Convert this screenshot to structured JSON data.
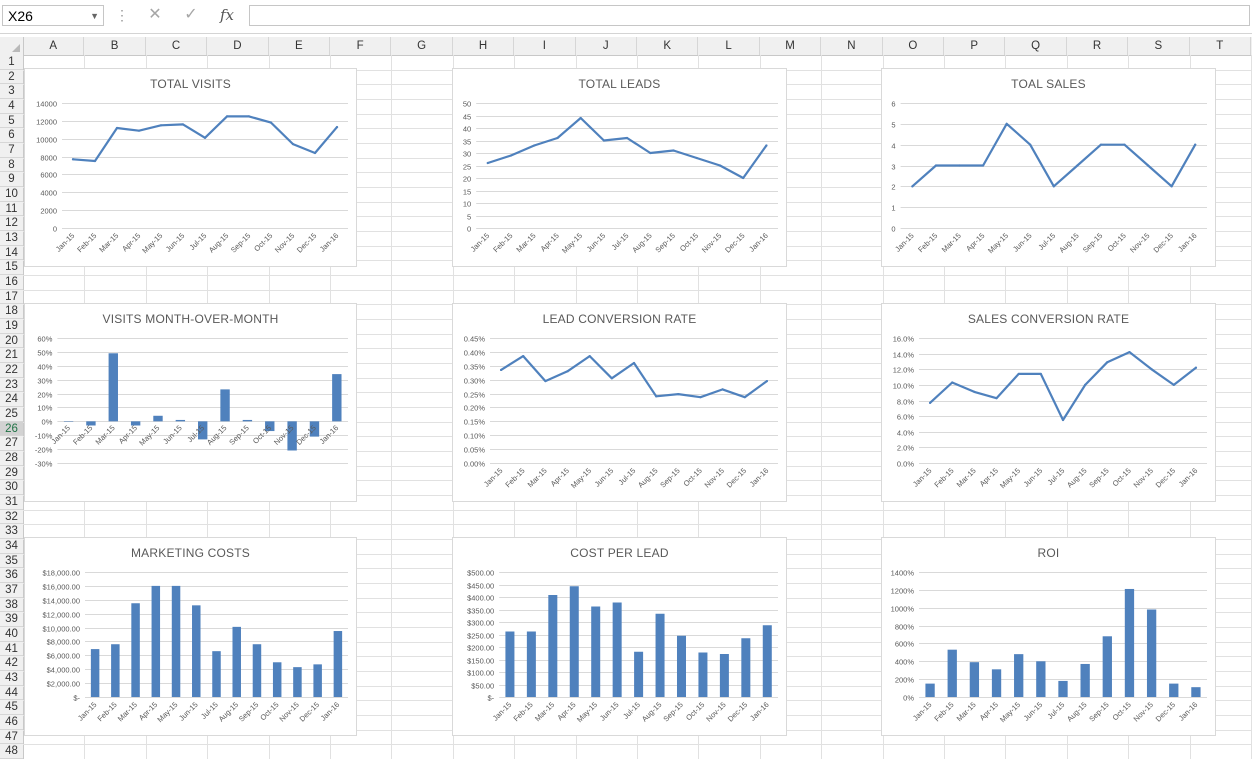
{
  "formula_bar": {
    "name_box": "X26",
    "fx_label": "fx",
    "formula": ""
  },
  "columns": [
    "A",
    "B",
    "C",
    "D",
    "E",
    "F",
    "G",
    "H",
    "I",
    "J",
    "K",
    "L",
    "M",
    "N",
    "O",
    "P",
    "Q",
    "R",
    "S",
    "T"
  ],
  "rows": [
    "1",
    "2",
    "3",
    "4",
    "5",
    "6",
    "7",
    "8",
    "9",
    "10",
    "11",
    "12",
    "13",
    "14",
    "15",
    "16",
    "17",
    "18",
    "19",
    "20",
    "21",
    "22",
    "23",
    "24",
    "25",
    "26",
    "27",
    "28",
    "29",
    "30",
    "31",
    "32",
    "33",
    "34",
    "35",
    "36",
    "37",
    "38",
    "39",
    "40",
    "41",
    "42",
    "43",
    "44",
    "45",
    "46",
    "47",
    "48"
  ],
  "selected_row": "26",
  "colors": {
    "series": "#4f81bd",
    "gridline": "#d9d9d9",
    "axis_text": "#595959",
    "header_bg": "#f0f0f0"
  },
  "chart_data": [
    {
      "type": "line",
      "title": "TOTAL VISITS",
      "categories": [
        "Jan-15",
        "Feb-15",
        "Mar-15",
        "Apr-15",
        "May-15",
        "Jun-15",
        "Jul-15",
        "Aug-15",
        "Sep-15",
        "Oct-15",
        "Nov-15",
        "Dec-15",
        "Jan-16"
      ],
      "values": [
        7700,
        7500,
        11200,
        10900,
        11500,
        11600,
        10100,
        12500,
        12500,
        11800,
        9400,
        8400,
        11300
      ],
      "yticks": [
        0,
        2000,
        4000,
        6000,
        8000,
        10000,
        12000,
        14000
      ],
      "ytick_labels": [
        "0",
        "2000",
        "4000",
        "6000",
        "8000",
        "10000",
        "12000",
        "14000"
      ],
      "ylim": [
        0,
        14000
      ]
    },
    {
      "type": "line",
      "title": "TOTAL LEADS",
      "categories": [
        "Jan-15",
        "Feb-15",
        "Mar-15",
        "Apr-15",
        "May-15",
        "Jun-15",
        "Jul-15",
        "Aug-15",
        "Sep-15",
        "Oct-15",
        "Nov-15",
        "Dec-15",
        "Jan-16"
      ],
      "values": [
        26,
        29,
        33,
        36,
        44,
        35,
        36,
        30,
        31,
        28,
        25,
        20,
        33
      ],
      "yticks": [
        0,
        5,
        10,
        15,
        20,
        25,
        30,
        35,
        40,
        45,
        50
      ],
      "ytick_labels": [
        "0",
        "5",
        "10",
        "15",
        "20",
        "25",
        "30",
        "35",
        "40",
        "45",
        "50"
      ],
      "ylim": [
        0,
        50
      ]
    },
    {
      "type": "line",
      "title": "TOAL SALES",
      "categories": [
        "Jan-15",
        "Feb-15",
        "Mar-15",
        "Apr-15",
        "May-15",
        "Jun-15",
        "Jul-15",
        "Aug-15",
        "Sep-15",
        "Oct-15",
        "Nov-15",
        "Dec-15",
        "Jan-16"
      ],
      "values": [
        2,
        3,
        3,
        3,
        5,
        4,
        2,
        3,
        4,
        4,
        3,
        2,
        4
      ],
      "yticks": [
        0,
        1,
        2,
        3,
        4,
        5,
        6
      ],
      "ytick_labels": [
        "0",
        "1",
        "2",
        "3",
        "4",
        "5",
        "6"
      ],
      "ylim": [
        0,
        6
      ]
    },
    {
      "type": "bar",
      "title": "VISITS MONTH-OVER-MONTH",
      "categories": [
        "Jan-15",
        "Feb-15",
        "Mar-15",
        "Apr-15",
        "May-15",
        "Jun-15",
        "Jul-15",
        "Aug-15",
        "Sep-15",
        "Oct-15",
        "Nov-15",
        "Dec-15",
        "Jan-16"
      ],
      "values": [
        0,
        -3,
        49,
        -3,
        4,
        1,
        -13,
        23,
        1,
        -7,
        -21,
        -11,
        34
      ],
      "value_unit": "%",
      "yticks": [
        -30,
        -20,
        -10,
        0,
        10,
        20,
        30,
        40,
        50,
        60
      ],
      "ytick_labels": [
        "-30%",
        "-20%",
        "-10%",
        "0%",
        "10%",
        "20%",
        "30%",
        "40%",
        "50%",
        "60%"
      ],
      "ylim": [
        -30,
        60
      ]
    },
    {
      "type": "line",
      "title": "LEAD CONVERSION RATE",
      "categories": [
        "Jan-15",
        "Feb-15",
        "Mar-15",
        "Apr-15",
        "May-15",
        "Jun-15",
        "Jul-15",
        "Aug-15",
        "Sep-15",
        "Oct-15",
        "Nov-15",
        "Dec-15",
        "Jan-16"
      ],
      "values": [
        0.335,
        0.385,
        0.295,
        0.33,
        0.385,
        0.305,
        0.36,
        0.24,
        0.248,
        0.237,
        0.265,
        0.237,
        0.295
      ],
      "value_unit": "%",
      "yticks": [
        0,
        0.05,
        0.1,
        0.15,
        0.2,
        0.25,
        0.3,
        0.35,
        0.4,
        0.45
      ],
      "ytick_labels": [
        "0.00%",
        "0.05%",
        "0.10%",
        "0.15%",
        "0.20%",
        "0.25%",
        "0.30%",
        "0.35%",
        "0.40%",
        "0.45%"
      ],
      "ylim": [
        0,
        0.45
      ]
    },
    {
      "type": "line",
      "title": "SALES CONVERSION RATE",
      "categories": [
        "Jan-15",
        "Feb-15",
        "Mar-15",
        "Apr-15",
        "May-15",
        "Jun-15",
        "Jul-15",
        "Aug-15",
        "Sep-15",
        "Oct-15",
        "Nov-15",
        "Dec-15",
        "Jan-16"
      ],
      "values": [
        7.7,
        10.3,
        9.1,
        8.3,
        11.4,
        11.4,
        5.5,
        10.0,
        12.9,
        14.2,
        12.0,
        10.0,
        12.2
      ],
      "value_unit": "%",
      "yticks": [
        0,
        2,
        4,
        6,
        8,
        10,
        12,
        14,
        16
      ],
      "ytick_labels": [
        "0.0%",
        "2.0%",
        "4.0%",
        "6.0%",
        "8.0%",
        "10.0%",
        "12.0%",
        "14.0%",
        "16.0%"
      ],
      "ylim": [
        0,
        16
      ]
    },
    {
      "type": "bar",
      "title": "MARKETING COSTS",
      "categories": [
        "Jan-15",
        "Feb-15",
        "Mar-15",
        "Apr-15",
        "May-15",
        "Jun-15",
        "Jul-15",
        "Aug-15",
        "Sep-15",
        "Oct-15",
        "Nov-15",
        "Dec-15",
        "Jan-16"
      ],
      "values": [
        6900,
        7600,
        13500,
        16000,
        16000,
        13200,
        6600,
        10100,
        7600,
        5000,
        4300,
        4700,
        9500
      ],
      "yticks": [
        0,
        2000,
        4000,
        6000,
        8000,
        10000,
        12000,
        14000,
        16000,
        18000
      ],
      "ytick_labels": [
        "$-",
        "$2,000.00",
        "$4,000.00",
        "$6,000.00",
        "$8,000.00",
        "$10,000.00",
        "$12,000.00",
        "$14,000.00",
        "$16,000.00",
        "$18,000.00"
      ],
      "ylim": [
        0,
        18000
      ]
    },
    {
      "type": "bar",
      "title": "COST PER LEAD",
      "categories": [
        "Jan-15",
        "Feb-15",
        "Mar-15",
        "Apr-15",
        "May-15",
        "Jun-15",
        "Jul-15",
        "Aug-15",
        "Sep-15",
        "Oct-15",
        "Nov-15",
        "Dec-15",
        "Jan-16"
      ],
      "values": [
        262,
        262,
        408,
        443,
        362,
        378,
        181,
        333,
        245,
        178,
        172,
        235,
        287
      ],
      "yticks": [
        0,
        50,
        100,
        150,
        200,
        250,
        300,
        350,
        400,
        450,
        500
      ],
      "ytick_labels": [
        "$-",
        "$50.00",
        "$100.00",
        "$150.00",
        "$200.00",
        "$250.00",
        "$300.00",
        "$350.00",
        "$400.00",
        "$450.00",
        "$500.00"
      ],
      "ylim": [
        0,
        500
      ]
    },
    {
      "type": "bar",
      "title": "ROI",
      "categories": [
        "Jan-15",
        "Feb-15",
        "Mar-15",
        "Apr-15",
        "May-15",
        "Jun-15",
        "Jul-15",
        "Aug-15",
        "Sep-15",
        "Oct-15",
        "Nov-15",
        "Dec-15",
        "Jan-16"
      ],
      "values": [
        150,
        530,
        390,
        310,
        480,
        400,
        180,
        370,
        680,
        1210,
        980,
        150,
        110
      ],
      "value_unit": "%",
      "yticks": [
        0,
        200,
        400,
        600,
        800,
        1000,
        1200,
        1400
      ],
      "ytick_labels": [
        "0%",
        "200%",
        "400%",
        "600%",
        "800%",
        "1000%",
        "1200%",
        "1400%"
      ],
      "ylim": [
        0,
        1400
      ]
    }
  ]
}
